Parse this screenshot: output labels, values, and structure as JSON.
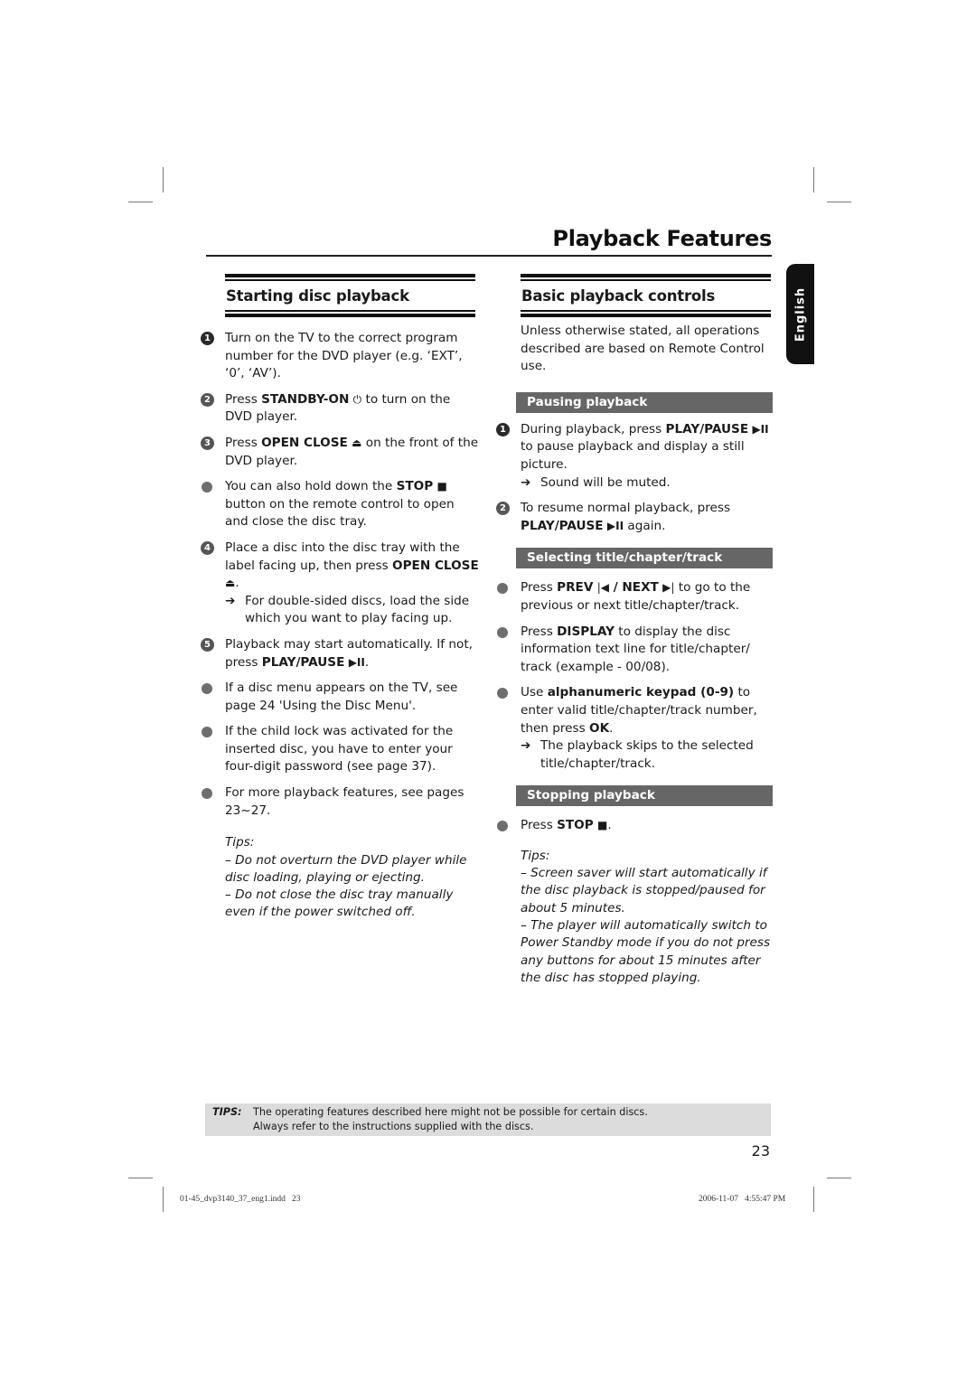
{
  "page": {
    "title": "Playback Features",
    "language_tab": "English",
    "page_number": "23"
  },
  "left": {
    "heading": "Starting disc playback",
    "steps": [
      {
        "marker": "1",
        "text": "Turn on the TV to the correct program number for the DVD player (e.g. ‘EXT’, ‘0’, ‘AV’)."
      },
      {
        "marker": "2",
        "pre": "Press ",
        "bold": "STANDBY-ON",
        "icon": "⏻",
        "post": " to turn on the DVD player."
      },
      {
        "marker": "3",
        "pre": "Press ",
        "bold": "OPEN CLOSE",
        "icon": "⏏",
        "post": " on the front of the DVD player."
      },
      {
        "marker": "•",
        "pre": "You can also hold down the ",
        "bold": "STOP",
        "icon": "■",
        "post": " button on the remote control to open and close the disc tray."
      },
      {
        "marker": "4",
        "pre": "Place a disc into the disc tray with the label facing up, then press ",
        "bold": "OPEN CLOSE",
        "icon": "⏏",
        "post": ".",
        "result": "For double-sided discs, load the side which you want to play facing up."
      },
      {
        "marker": "5",
        "pre": "Playback may start automatically. If not, press ",
        "bold": "PLAY/PAUSE",
        "icon": "▶II",
        "post": "."
      },
      {
        "marker": "•",
        "text": "If a disc menu appears on the TV, see page 24 'Using the Disc Menu'."
      },
      {
        "marker": "•",
        "text": "If the child lock was activated for the inserted disc, you have to enter your four-digit password (see page 37)."
      },
      {
        "marker": "•",
        "text": "For more playback features, see pages 23~27."
      }
    ],
    "tips_label": "Tips:",
    "tips": [
      "– Do not overturn the DVD player while disc loading, playing or ejecting.",
      "– Do not close the disc tray manually even if the power switched off."
    ]
  },
  "right": {
    "heading": "Basic playback controls",
    "intro": "Unless otherwise stated, all operations described are based on Remote Control use.",
    "pausing": {
      "title": "Pausing playback",
      "step1_pre": "During playback, press ",
      "step1_bold": "PLAY/PAUSE",
      "step1_icon": "▶II",
      "step1_post": " to pause playback and display a still picture.",
      "step1_result": "Sound will be muted.",
      "step2_pre": "To resume normal playback, press ",
      "step2_bold": "PLAY/PAUSE",
      "step2_icon": "▶II",
      "step2_post": " again."
    },
    "selecting": {
      "title": "Selecting title/chapter/track",
      "b1_pre": "Press ",
      "b1_bold1": "PREV",
      "b1_icon1": "|◀",
      "b1_sep": " / ",
      "b1_bold2": "NEXT",
      "b1_icon2": "▶|",
      "b1_post": " to go to the previous or next title/chapter/track.",
      "b2_pre": "Press ",
      "b2_bold": "DISPLAY",
      "b2_post": " to display the disc information text line for title/chapter/ track (example - 00/08).",
      "b3_pre": "Use ",
      "b3_bold": "alphanumeric keypad (0-9)",
      "b3_mid": " to enter valid title/chapter/track number, then press ",
      "b3_bold2": "OK",
      "b3_post": ".",
      "b3_result": "The playback skips to the selected title/chapter/track."
    },
    "stopping": {
      "title": "Stopping playback",
      "b1_pre": "Press ",
      "b1_bold": "STOP",
      "b1_icon": "■",
      "b1_post": "."
    },
    "tips_label": "Tips:",
    "tips": [
      "– Screen saver will start automatically if the disc playback is stopped/paused for about 5 minutes.",
      "– The player will automatically switch to Power Standby mode if you do not press any buttons for about 15 minutes after the disc has stopped playing."
    ]
  },
  "footer_tips": {
    "label": "TIPS:",
    "line1": "The operating features described here might not be possible for certain discs.",
    "line2": "Always refer to the instructions supplied with the discs."
  },
  "slug": {
    "file": "01-45_dvp3140_37_eng1.indd   23",
    "timestamp": "2006-11-07   4:55:47 PM"
  },
  "icons": {
    "result_arrow": "➔"
  }
}
